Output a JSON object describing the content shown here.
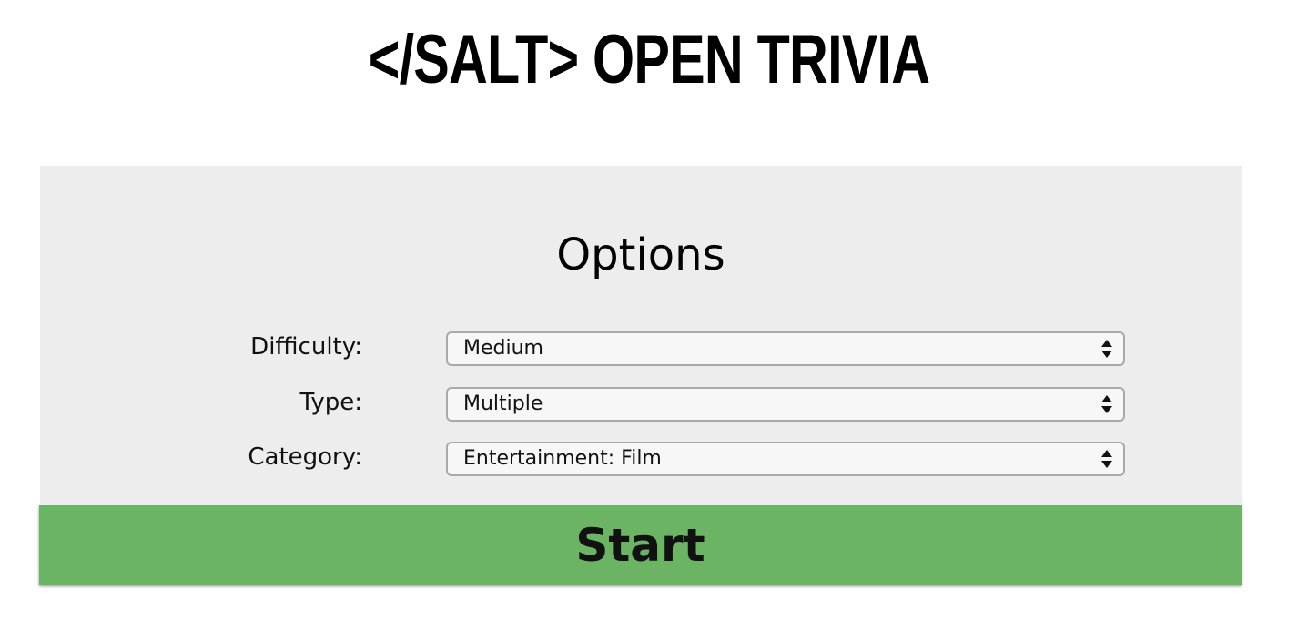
{
  "app": {
    "title": "</SALT> OPEN TRIVIA"
  },
  "options": {
    "heading": "Options",
    "difficulty": {
      "label": "Difficulty:",
      "selected": "Medium"
    },
    "type": {
      "label": "Type:",
      "selected": "Multiple"
    },
    "category": {
      "label": "Category:",
      "selected": "Entertainment: Film"
    }
  },
  "actions": {
    "start_label": "Start"
  },
  "colors": {
    "panel_background": "#ededed",
    "start_button": "#6ab463",
    "select_border": "#a9a9a9"
  },
  "icons": {
    "select_arrows": "updown-arrows-icon"
  }
}
